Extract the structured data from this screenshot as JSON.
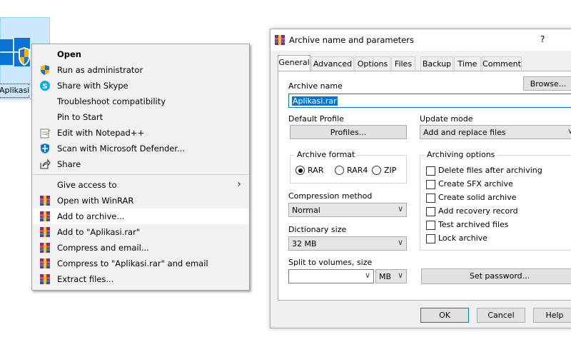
{
  "desktop_icon": {
    "label": "Aplikasi"
  },
  "context_menu": {
    "items": [
      {
        "label": "Open",
        "bold": true,
        "icon": "none"
      },
      {
        "label": "Run as administrator",
        "icon": "shield-icon"
      },
      {
        "label": "Share with Skype",
        "icon": "skype-icon"
      },
      {
        "label": "Troubleshoot compatibility",
        "icon": "none"
      },
      {
        "label": "Pin to Start",
        "icon": "none"
      },
      {
        "label": "Edit with Notepad++",
        "icon": "notepad-plus-plus-icon"
      },
      {
        "label": "Scan with Microsoft Defender...",
        "icon": "defender-icon"
      },
      {
        "label": "Share",
        "icon": "share-icon"
      },
      {
        "label": "Give access to",
        "icon": "none",
        "submenu": true
      },
      {
        "label": "Open with WinRAR",
        "icon": "winrar-icon"
      },
      {
        "label": "Add to archive...",
        "icon": "winrar-icon",
        "highlighted": true
      },
      {
        "label": "Add to \"Aplikasi.rar\"",
        "icon": "winrar-icon"
      },
      {
        "label": "Compress and email...",
        "icon": "winrar-icon"
      },
      {
        "label": "Compress to \"Aplikasi.rar\" and email",
        "icon": "winrar-icon"
      },
      {
        "label": "Extract files...",
        "icon": "winrar-icon"
      }
    ]
  },
  "dialog": {
    "title": "Archive name and parameters",
    "help_glyph": "?",
    "tabs": [
      "General",
      "Advanced",
      "Options",
      "Files",
      "Backup",
      "Time",
      "Comment"
    ],
    "active_tab": "General",
    "archive_name_label": "Archive name",
    "browse_label": "Browse...",
    "archive_name_value": "Aplikasi.rar",
    "default_profile_label": "Default Profile",
    "profiles_label": "Profiles...",
    "update_mode_label": "Update mode",
    "update_mode_value": "Add and replace files",
    "archive_format_label": "Archive format",
    "formats": [
      {
        "label": "RAR",
        "selected": true
      },
      {
        "label": "RAR4",
        "selected": false
      },
      {
        "label": "ZIP",
        "selected": false
      }
    ],
    "compression_method_label": "Compression method",
    "compression_method_value": "Normal",
    "dictionary_size_label": "Dictionary size",
    "dictionary_size_value": "32 MB",
    "split_label": "Split to volumes, size",
    "split_value": "",
    "split_unit": "MB",
    "archiving_options_label": "Archiving options",
    "options": [
      {
        "label": "Delete files after archiving",
        "checked": false
      },
      {
        "label": "Create SFX archive",
        "checked": false
      },
      {
        "label": "Create solid archive",
        "checked": false
      },
      {
        "label": "Add recovery record",
        "checked": false
      },
      {
        "label": "Test archived files",
        "checked": false
      },
      {
        "label": "Lock archive",
        "checked": false
      }
    ],
    "set_password_label": "Set password...",
    "ok_label": "OK",
    "cancel_label": "Cancel",
    "help_label": "Help"
  },
  "colors": {
    "accent": "#0078d7",
    "selection_bg": "#cce8ff",
    "menu_bg": "#f2f2f2"
  }
}
